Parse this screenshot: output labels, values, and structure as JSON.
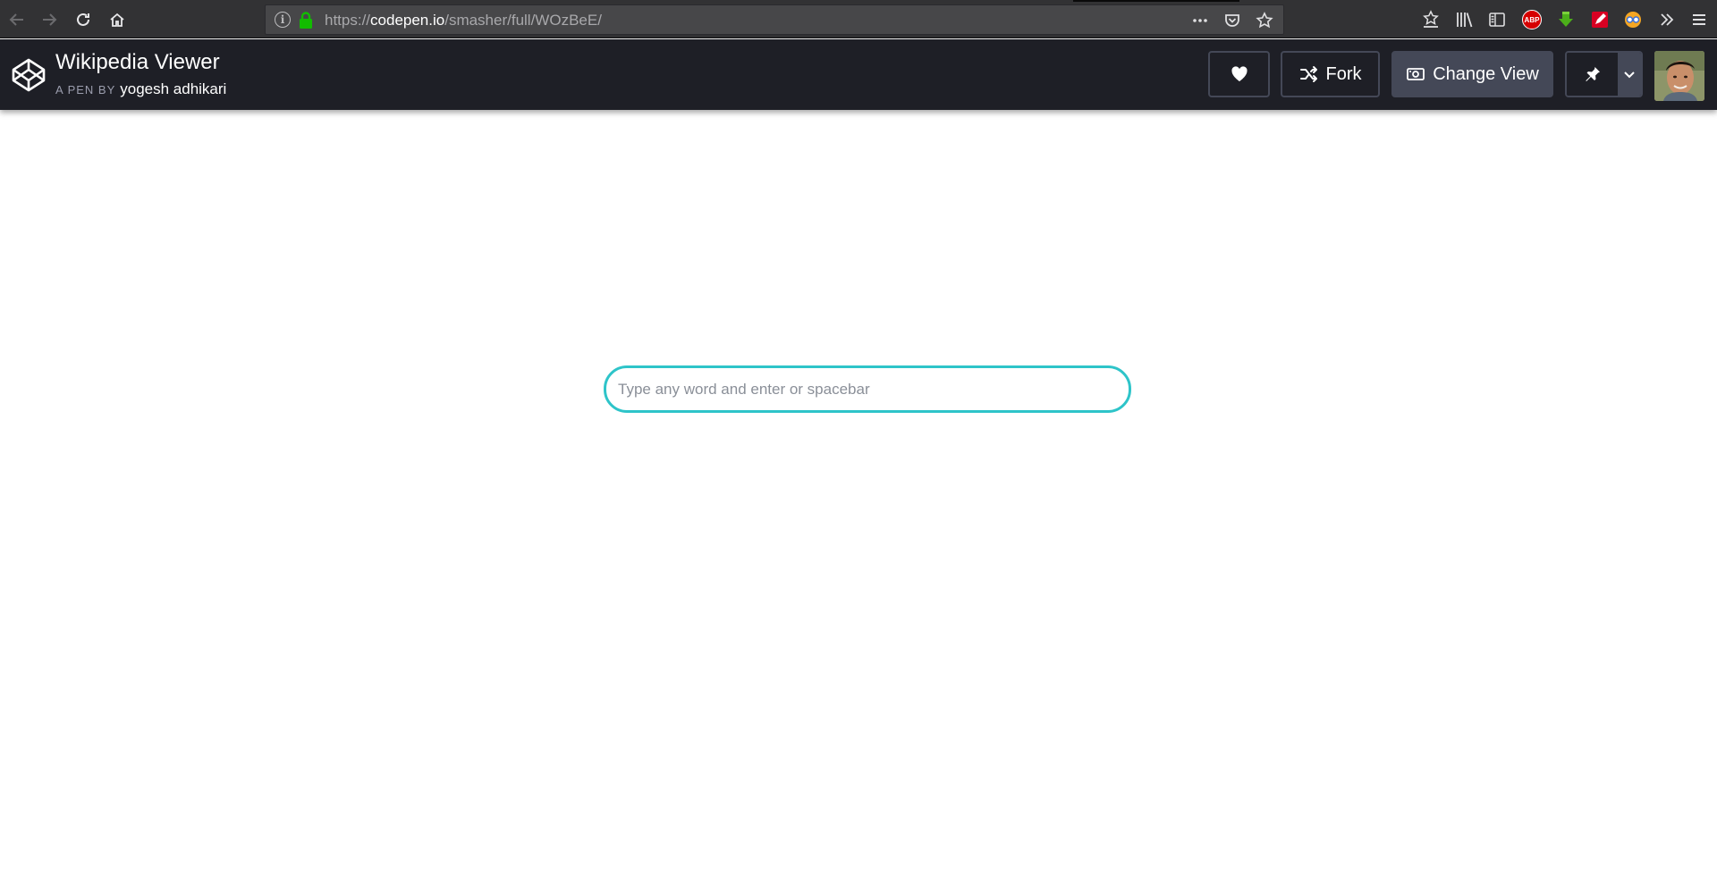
{
  "browser": {
    "url_scheme": "https://",
    "url_host": "codepen.io",
    "url_path": "/smasher/full/WOzBeE/",
    "info_glyph": "i",
    "abp_label": "ABP"
  },
  "pen": {
    "title": "Wikipedia Viewer",
    "byline_prefix": "A PEN BY",
    "author": "yogesh adhikari"
  },
  "actions": {
    "fork_label": "Fork",
    "change_view_label": "Change View"
  },
  "search": {
    "placeholder": "Type any word and enter or spacebar"
  },
  "colors": {
    "browser_bar": "#323234",
    "header_bg": "#1e1f26",
    "button_border": "#444857",
    "search_border": "#2ec4c9",
    "abp_red": "#d60000"
  },
  "icons": {
    "browser": [
      "back-icon",
      "forward-icon",
      "reload-icon",
      "home-icon",
      "info-icon",
      "lock-icon",
      "more-icon",
      "pocket-icon",
      "bookmark-star-icon"
    ],
    "toolbar": [
      "downloads-library-icon",
      "library-icon",
      "sidebar-icon",
      "adblock-icon",
      "download-arrow-icon",
      "pen-extension-icon",
      "extension-icon",
      "overflow-chevron-icon",
      "hamburger-menu-icon"
    ],
    "header": [
      "codepen-logo-icon",
      "heart-icon",
      "fork-icon",
      "change-view-icon",
      "pin-icon",
      "chevron-down-icon"
    ]
  }
}
